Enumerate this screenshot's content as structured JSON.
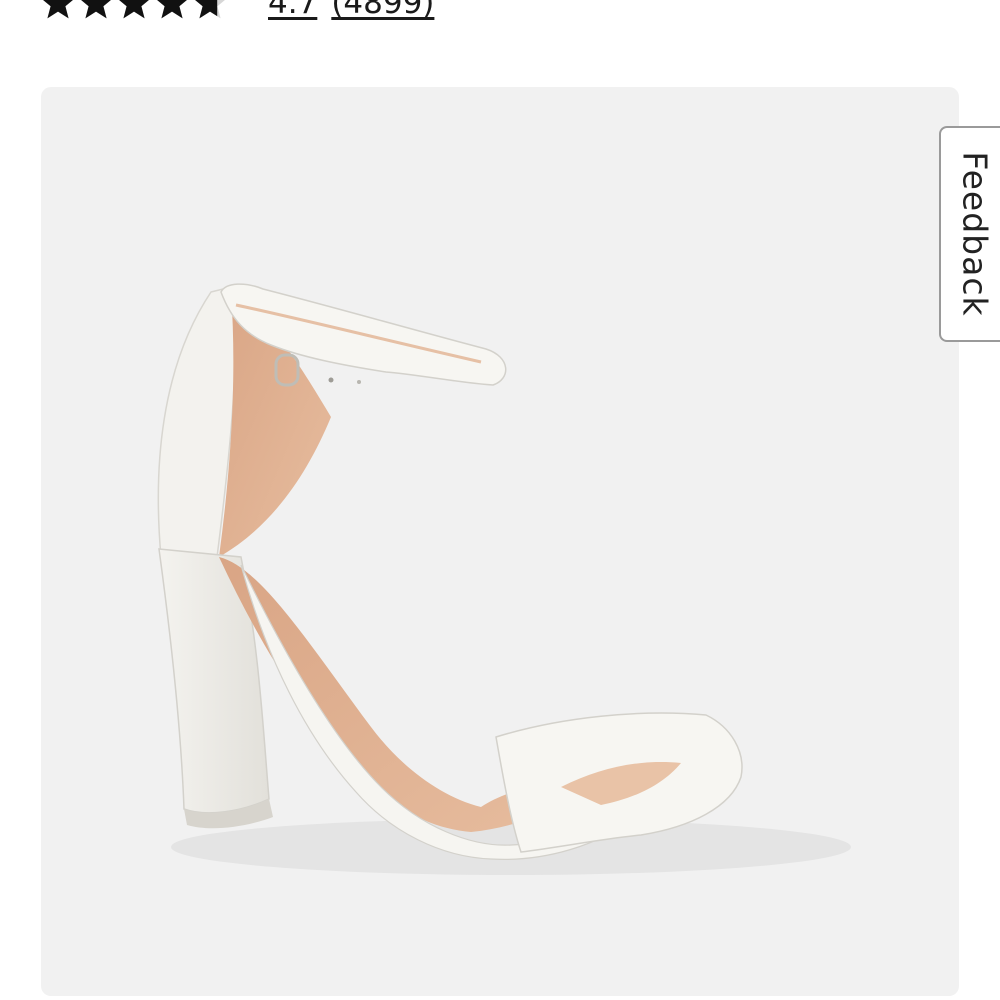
{
  "rating": {
    "stars": 4.7,
    "max_stars": 5,
    "score_text": "4.7",
    "count_text": "(4899)"
  },
  "product": {
    "image_icon": "white-block-heel-ankle-strap-sandal",
    "panel_color": "#f1f1f1"
  },
  "feedback": {
    "label": "Feedback"
  }
}
